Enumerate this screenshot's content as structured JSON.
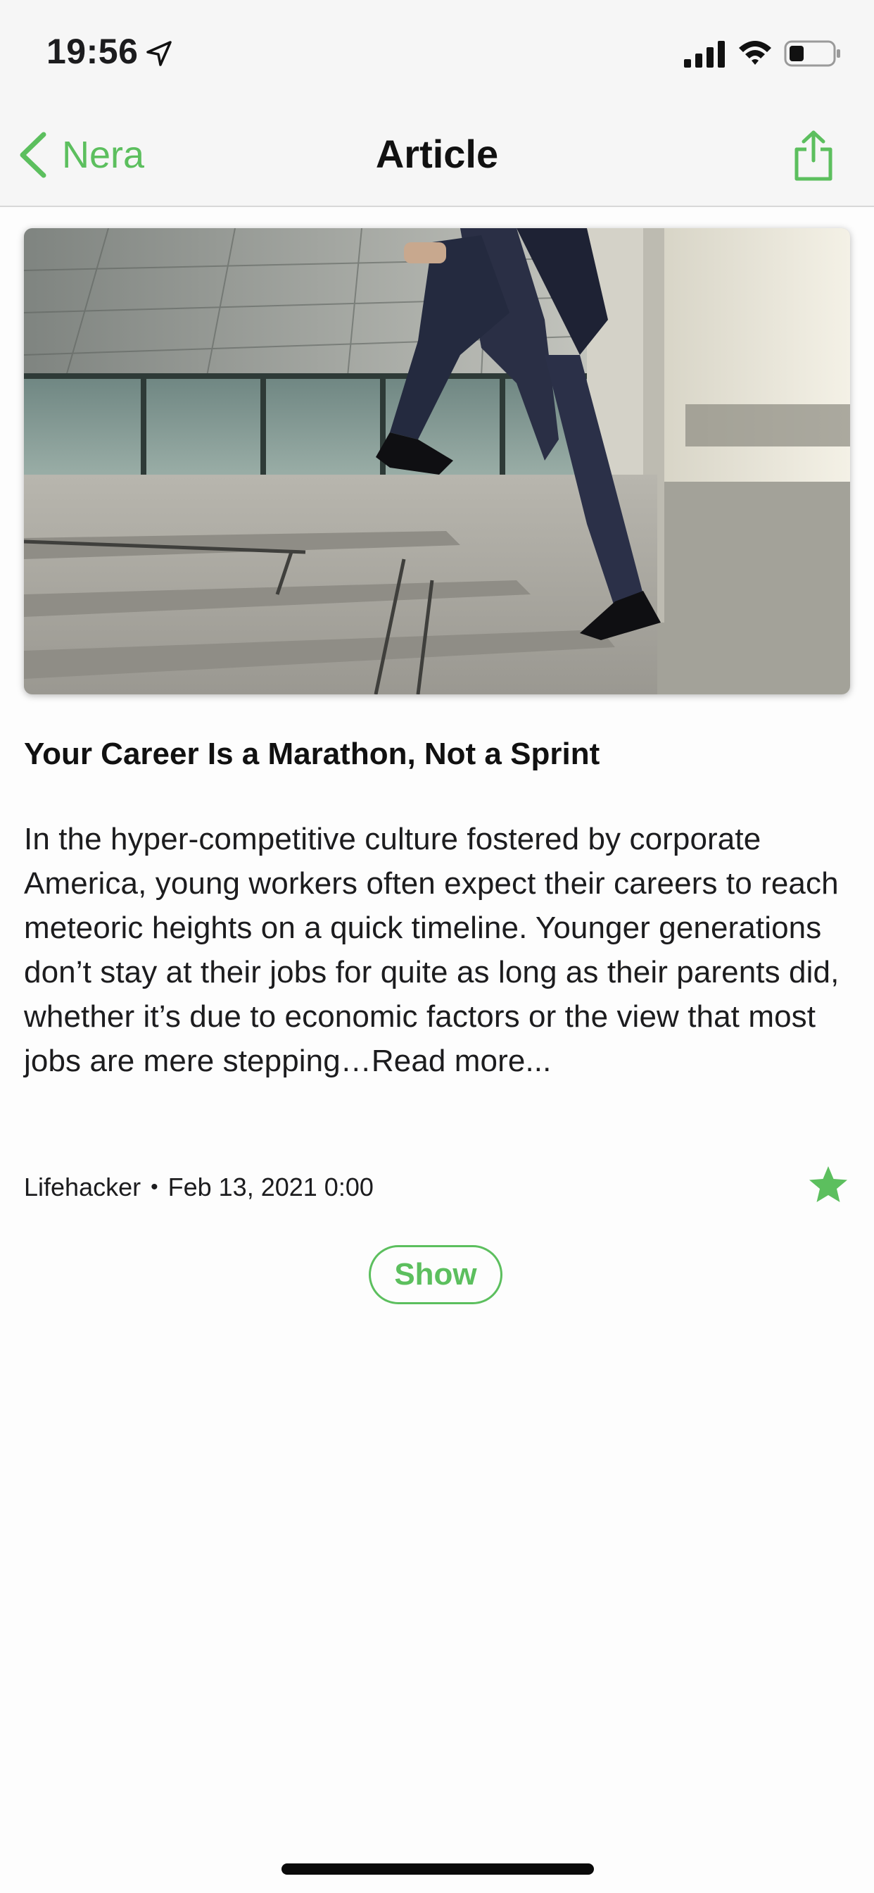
{
  "status_bar": {
    "time": "19:56",
    "icons": [
      "location-arrow-icon",
      "cellular-signal-icon",
      "wifi-icon",
      "battery-icon"
    ]
  },
  "nav": {
    "back_label": "Nera",
    "title": "Article",
    "share_icon": "share-icon"
  },
  "article": {
    "image_description_icon": "hero-image",
    "title": "Your Career Is a Marathon, Not a Sprint",
    "body": "In the hyper-competitive culture fostered by corporate America, young workers often expect their careers to reach meteoric heights on a quick timeline. Younger generations don’t stay at their jobs for quite as long as their parents did, whether it’s due to economic factors or the view that most jobs are mere stepping…",
    "read_more": "Read more...",
    "source": "Lifehacker",
    "separator": "•",
    "date": "Feb 13, 2021 0:00",
    "star_icon": "star-icon",
    "show_label": "Show"
  },
  "colors": {
    "accent": "#5cbf5e",
    "bar_background": "#f6f6f6",
    "text": "#1c1c1e"
  }
}
